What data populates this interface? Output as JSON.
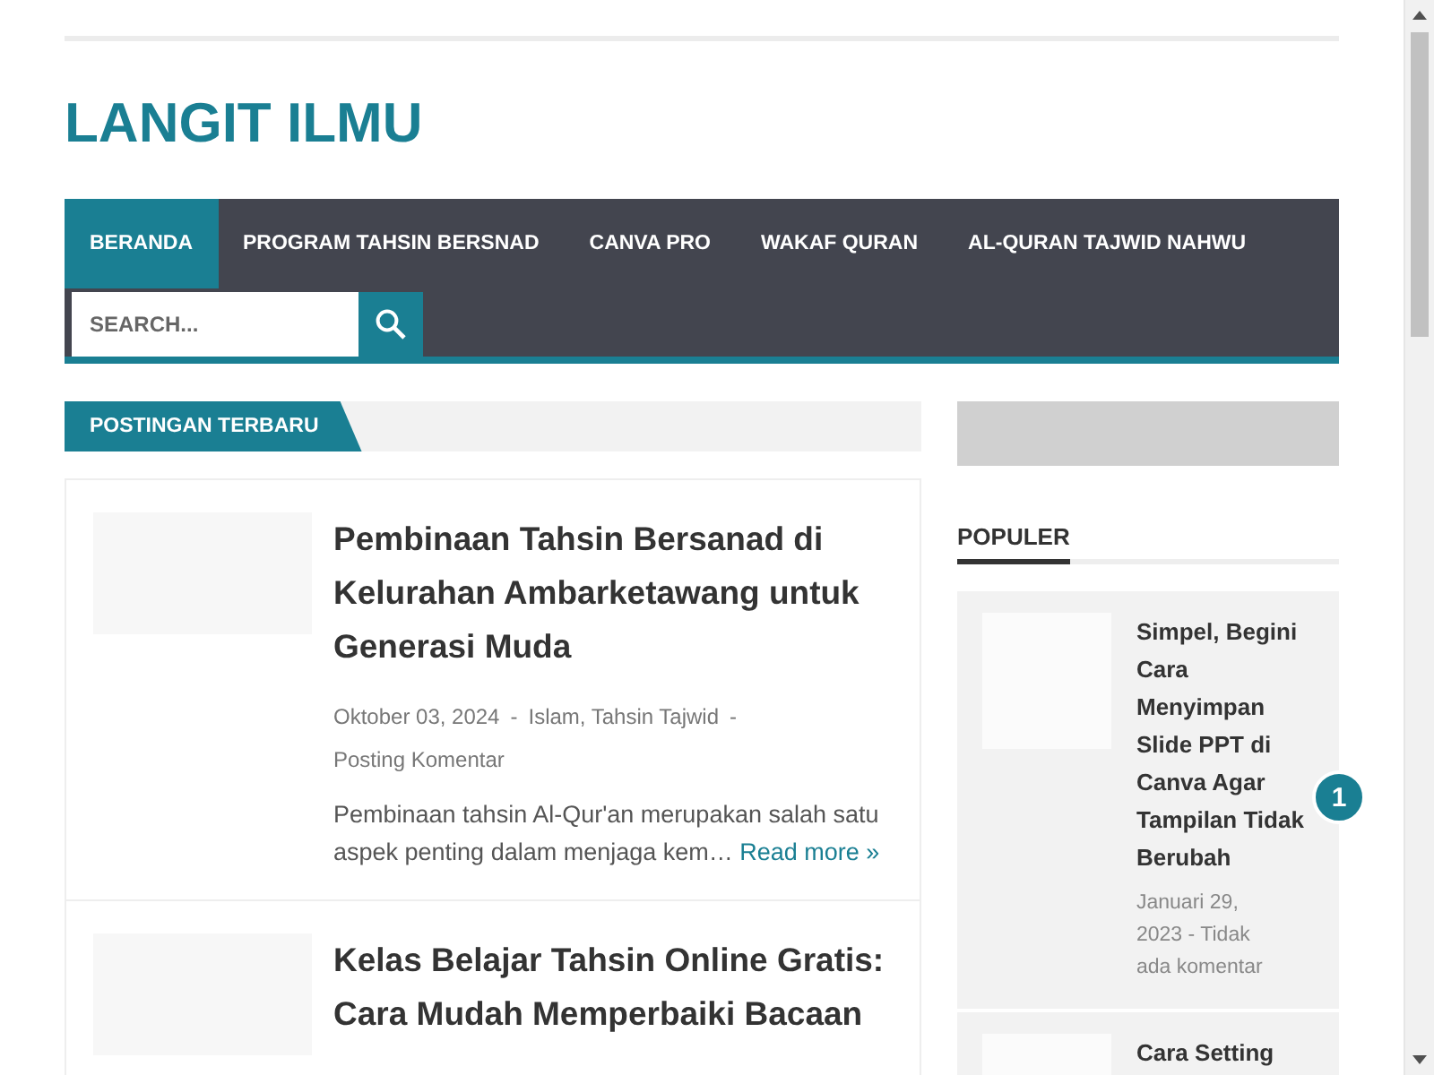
{
  "site_title": "LANGIT ILMU",
  "nav": {
    "tabs": [
      {
        "label": "BERANDA",
        "selected": true
      },
      {
        "label": "PROGRAM TAHSIN BERSNAD",
        "selected": false
      },
      {
        "label": "CANVA PRO",
        "selected": false
      },
      {
        "label": "WAKAF QURAN",
        "selected": false
      },
      {
        "label": "AL-QURAN TAJWID NAHWU",
        "selected": false
      }
    ],
    "search": {
      "placeholder": "SEARCH..."
    }
  },
  "main": {
    "heading": "POSTINGAN TERBARU",
    "posts": [
      {
        "title": "Pembinaan Tahsin Bersanad di Kelurahan Ambarketawang untuk Generasi Muda",
        "date": "Oktober 03, 2024",
        "separator": "-",
        "labels": "Islam, Tahsin Tajwid",
        "comments": "Posting Komentar",
        "snippet": "Pembinaan tahsin Al-Qur'an merupakan salah satu aspek penting dalam menjaga kem…",
        "read_more": "Read more »"
      },
      {
        "title": "Kelas Belajar Tahsin Online Gratis: Cara Mudah Memperbaiki Bacaan"
      }
    ]
  },
  "sidebar": {
    "heading": "POPULER",
    "popular": [
      {
        "title": "Simpel, Begini Cara Menyimpan Slide PPT di Canva Agar Tampilan Tidak Berubah",
        "rank": "1",
        "date": "Januari 29, 2023",
        "separator": "-",
        "comments": "Tidak ada komentar"
      },
      {
        "title": "Cara Setting"
      }
    ]
  }
}
